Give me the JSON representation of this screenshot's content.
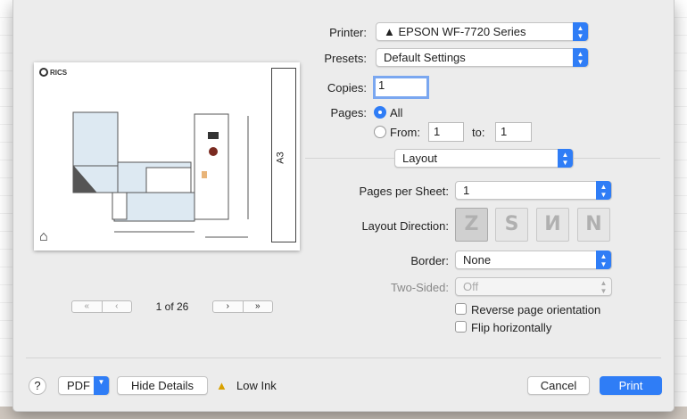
{
  "preview": {
    "logo_text": "RICS",
    "sheet_size": "A3",
    "page_indicator": "1 of 26"
  },
  "printer": {
    "label": "Printer:",
    "value": "EPSON WF-7720 Series"
  },
  "presets": {
    "label": "Presets:",
    "value": "Default Settings"
  },
  "copies": {
    "label": "Copies:",
    "value": "1"
  },
  "pages": {
    "label": "Pages:",
    "all_label": "All",
    "from_label": "From:",
    "from_value": "1",
    "to_label": "to:",
    "to_value": "1"
  },
  "section": {
    "value": "Layout"
  },
  "pages_per_sheet": {
    "label": "Pages per Sheet:",
    "value": "1"
  },
  "layout_direction": {
    "label": "Layout Direction:"
  },
  "border": {
    "label": "Border:",
    "value": "None"
  },
  "two_sided": {
    "label": "Two-Sided:",
    "value": "Off"
  },
  "reverse": {
    "label": "Reverse page orientation"
  },
  "flip": {
    "label": "Flip horizontally"
  },
  "footer": {
    "help": "?",
    "pdf": "PDF",
    "hide_details": "Hide Details",
    "low_ink": "Low Ink",
    "cancel": "Cancel",
    "print": "Print"
  },
  "colors": {
    "accent": "#2f7df6",
    "warning": "#d9a100"
  }
}
